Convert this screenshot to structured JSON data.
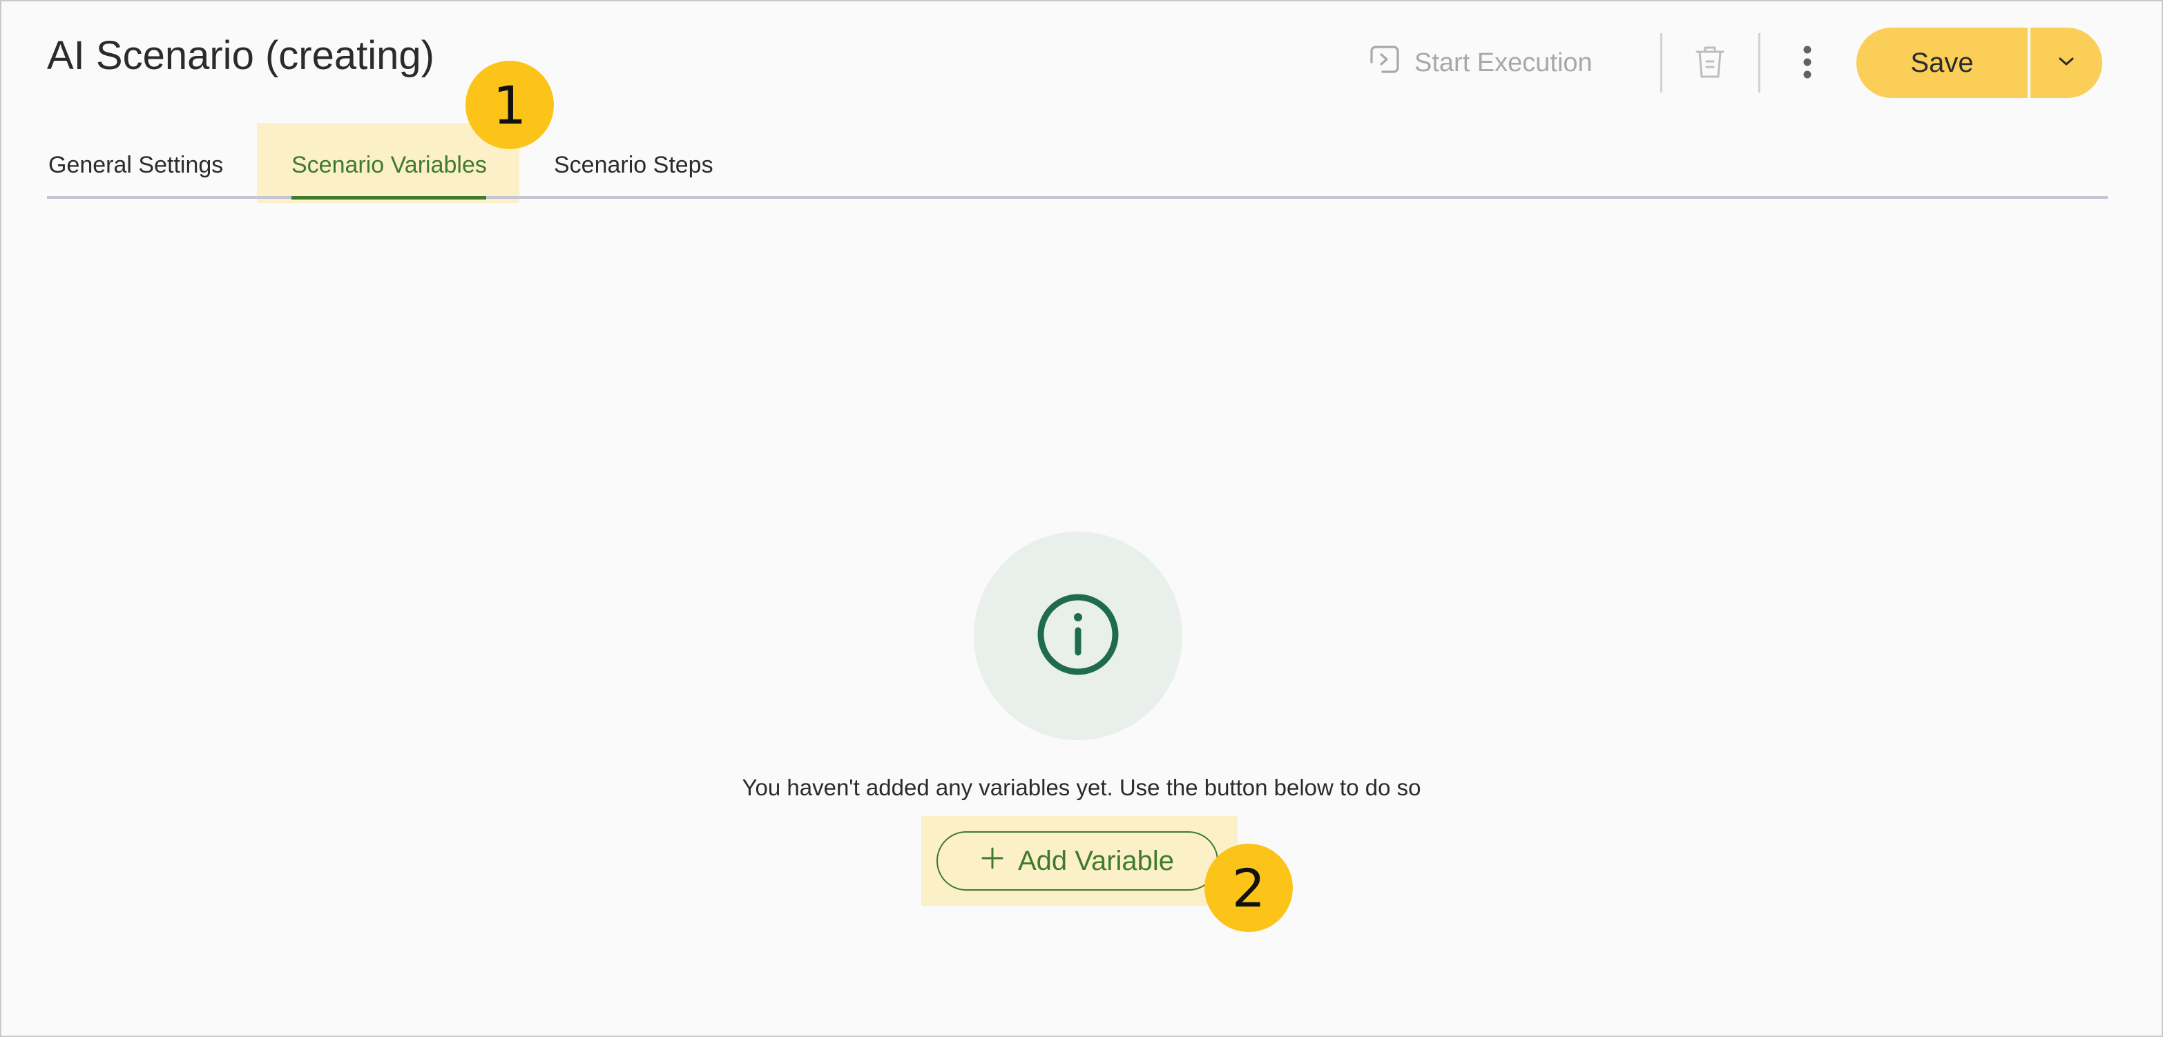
{
  "header": {
    "title": "AI Scenario (creating)"
  },
  "toolbar": {
    "start_execution_label": "Start Execution",
    "save_label": "Save",
    "icons": {
      "start_execution": "play-square-icon",
      "delete": "trash-icon",
      "more": "more-vertical-icon",
      "dropdown": "chevron-down-icon"
    }
  },
  "tabs": [
    {
      "label": "General Settings",
      "active": false
    },
    {
      "label": "Scenario Variables",
      "active": true
    },
    {
      "label": "Scenario Steps",
      "active": false
    }
  ],
  "annotations": [
    {
      "number": "1"
    },
    {
      "number": "2"
    }
  ],
  "empty_state": {
    "icon": "info-icon",
    "message": "You haven't added any variables yet. Use the button below to do so",
    "add_button_label": "Add Variable"
  },
  "colors": {
    "accent_green": "#3f7a2e",
    "save_yellow": "#fbce57",
    "badge_yellow": "#fcc419",
    "highlight": "#fbf0c8"
  }
}
